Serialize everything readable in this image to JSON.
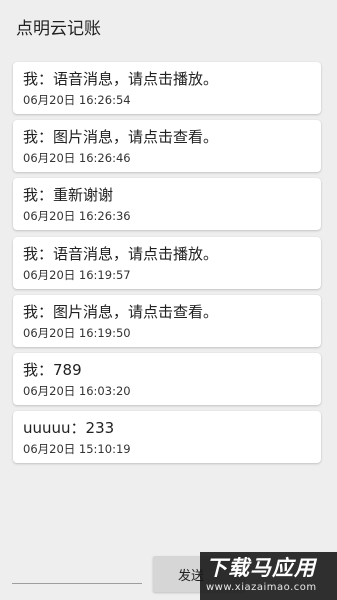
{
  "app_title": "点明云记账",
  "messages": [
    {
      "text": "我：语音消息，请点击播放。",
      "time": "06月20日 16:26:54"
    },
    {
      "text": "我：图片消息，请点击查看。",
      "time": "06月20日 16:26:46"
    },
    {
      "text": "我：重新谢谢",
      "time": "06月20日 16:26:36"
    },
    {
      "text": "我：语音消息，请点击播放。",
      "time": "06月20日 16:19:57"
    },
    {
      "text": "我：图片消息，请点击查看。",
      "time": "06月20日 16:19:50"
    },
    {
      "text": "我：789",
      "time": "06月20日 16:03:20"
    },
    {
      "text": "uuuuu：233",
      "time": "06月20日 15:10:19"
    }
  ],
  "composer": {
    "value": "",
    "send_label": "发送"
  },
  "watermark": {
    "main": "下载马应用",
    "url": "www.xiazaimao.com"
  }
}
